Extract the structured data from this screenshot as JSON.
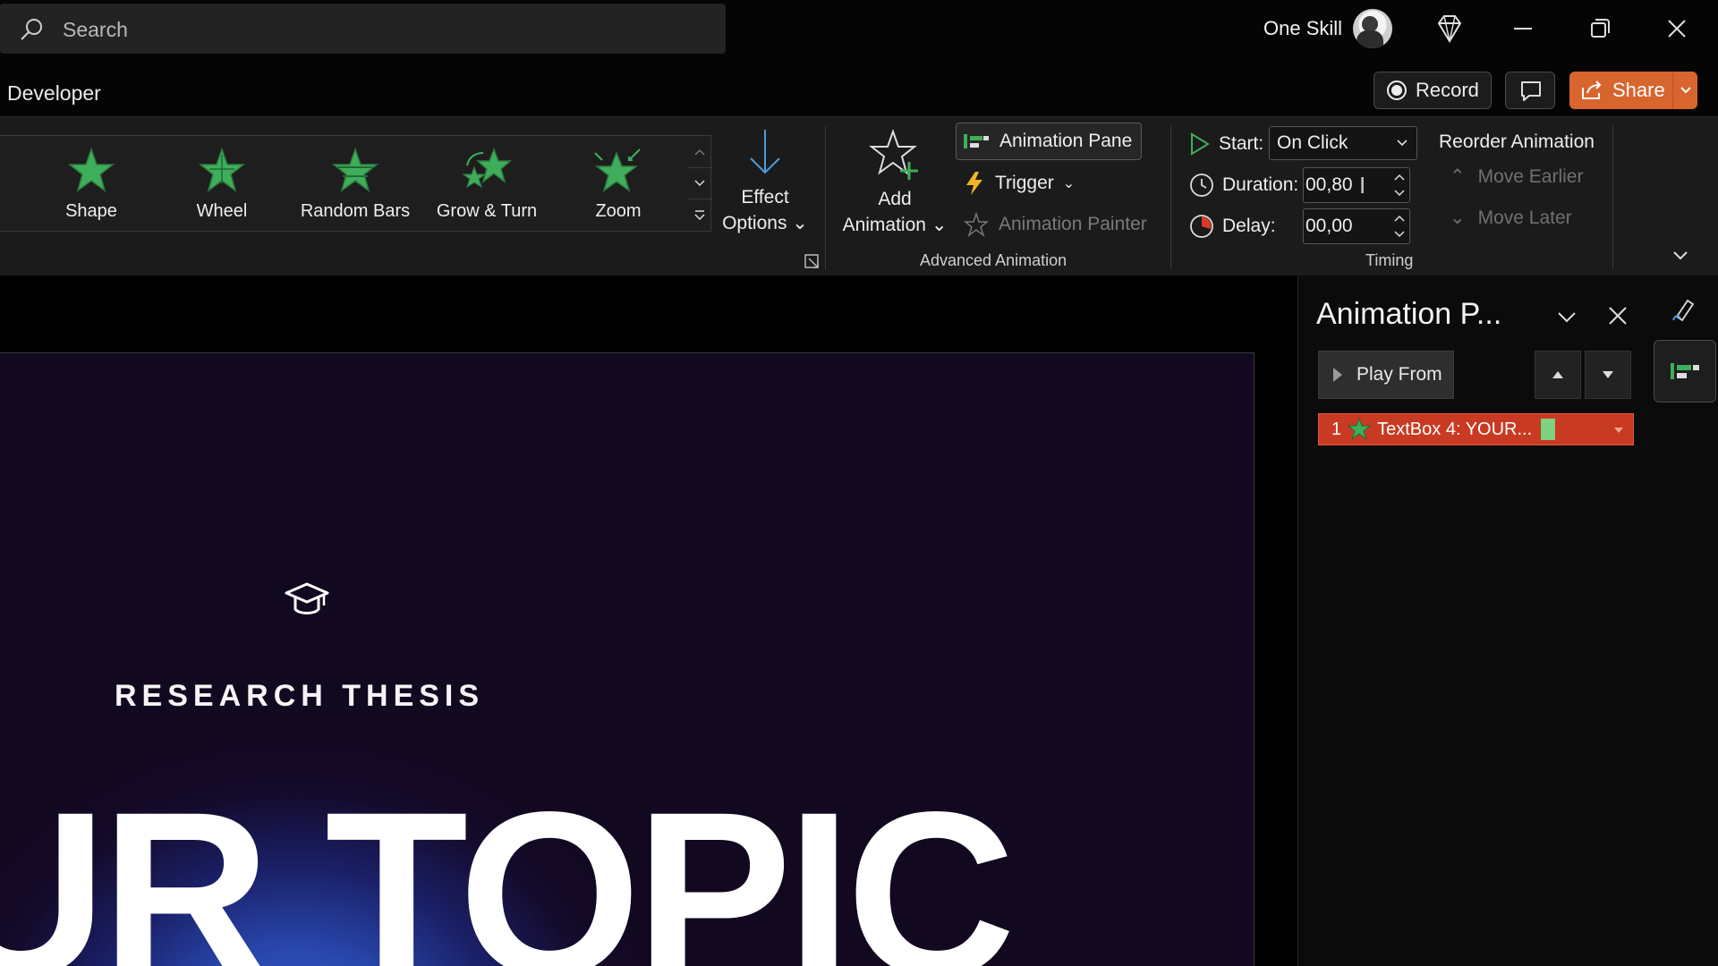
{
  "titlebar": {
    "search_placeholder": "Search",
    "account_name": "One Skill"
  },
  "tabs": {
    "active": "Developer"
  },
  "actions": {
    "record_label": "Record",
    "share_label": "Share"
  },
  "ribbon": {
    "gallery": [
      {
        "label": "Shape",
        "icon": "star-shape-icon"
      },
      {
        "label": "Wheel",
        "icon": "star-wheel-icon"
      },
      {
        "label": "Random Bars",
        "icon": "star-random-bars-icon"
      },
      {
        "label": "Grow & Turn",
        "icon": "star-grow-turn-icon"
      },
      {
        "label": "Zoom",
        "icon": "star-zoom-icon"
      }
    ],
    "effect_options": {
      "line1": "Effect",
      "line2": "Options"
    },
    "advanced": {
      "add_animation": {
        "line1": "Add",
        "line2": "Animation"
      },
      "animation_pane": "Animation Pane",
      "trigger": "Trigger",
      "animation_painter": "Animation Painter",
      "group_label": "Advanced Animation"
    },
    "timing": {
      "start_label": "Start:",
      "start_value": "On Click",
      "duration_label": "Duration:",
      "duration_value": "00,80",
      "delay_label": "Delay:",
      "delay_value": "00,00",
      "group_label": "Timing",
      "reorder_title": "Reorder Animation",
      "move_earlier": "Move Earlier",
      "move_later": "Move Later"
    }
  },
  "slide": {
    "subtitle": "RESEARCH THESIS",
    "title": "UR TOPIC"
  },
  "animation_pane": {
    "title": "Animation P...",
    "play_from": "Play From",
    "items": [
      {
        "index": "1",
        "label": "TextBox 4: YOUR..."
      }
    ]
  },
  "colors": {
    "accent_share": "#d8652e",
    "selected_item": "#c93a22",
    "star_green": "#3fae5a"
  }
}
